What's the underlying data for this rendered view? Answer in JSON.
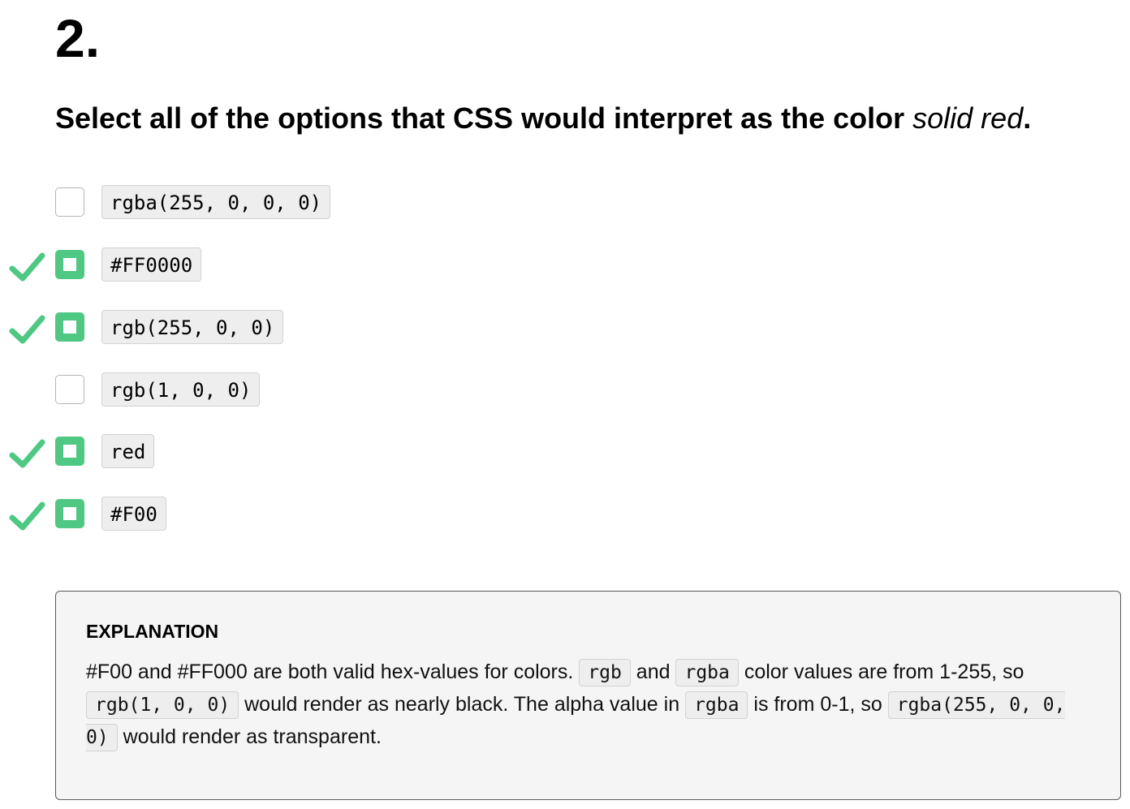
{
  "question": {
    "number": "2.",
    "text_before": "Select all of the options that CSS would interpret as the color ",
    "text_emphasis": "solid red",
    "text_after": "."
  },
  "options": [
    {
      "code": "rgba(255, 0, 0, 0)",
      "checked": false,
      "correct": false
    },
    {
      "code": "#FF0000",
      "checked": true,
      "correct": true
    },
    {
      "code": "rgb(255, 0, 0)",
      "checked": true,
      "correct": true
    },
    {
      "code": "rgb(1, 0, 0)",
      "checked": false,
      "correct": false
    },
    {
      "code": "red",
      "checked": true,
      "correct": true
    },
    {
      "code": "#F00",
      "checked": true,
      "correct": true
    }
  ],
  "explanation": {
    "title": "EXPLANATION",
    "p1": "#F00 and #FF000 are both valid hex-values for colors.",
    "c1": "rgb",
    "p2": "and",
    "c2": "rgba",
    "p3": "color values are from 1-255, so",
    "c3": "rgb(1, 0, 0)",
    "p4": "would render as nearly black. The alpha value in",
    "c4": "rgba",
    "p5": "is from 0-1, so",
    "c5": "rgba(255, 0, 0, 0)",
    "p6": "would render as transparent."
  },
  "colors": {
    "correct_green": "#4ec883",
    "code_background": "#eeeeee",
    "explanation_background": "#f5f5f5"
  },
  "icons": {
    "correct": "checkmark-icon",
    "selected": "checked-checkbox",
    "unselected": "empty-checkbox"
  }
}
